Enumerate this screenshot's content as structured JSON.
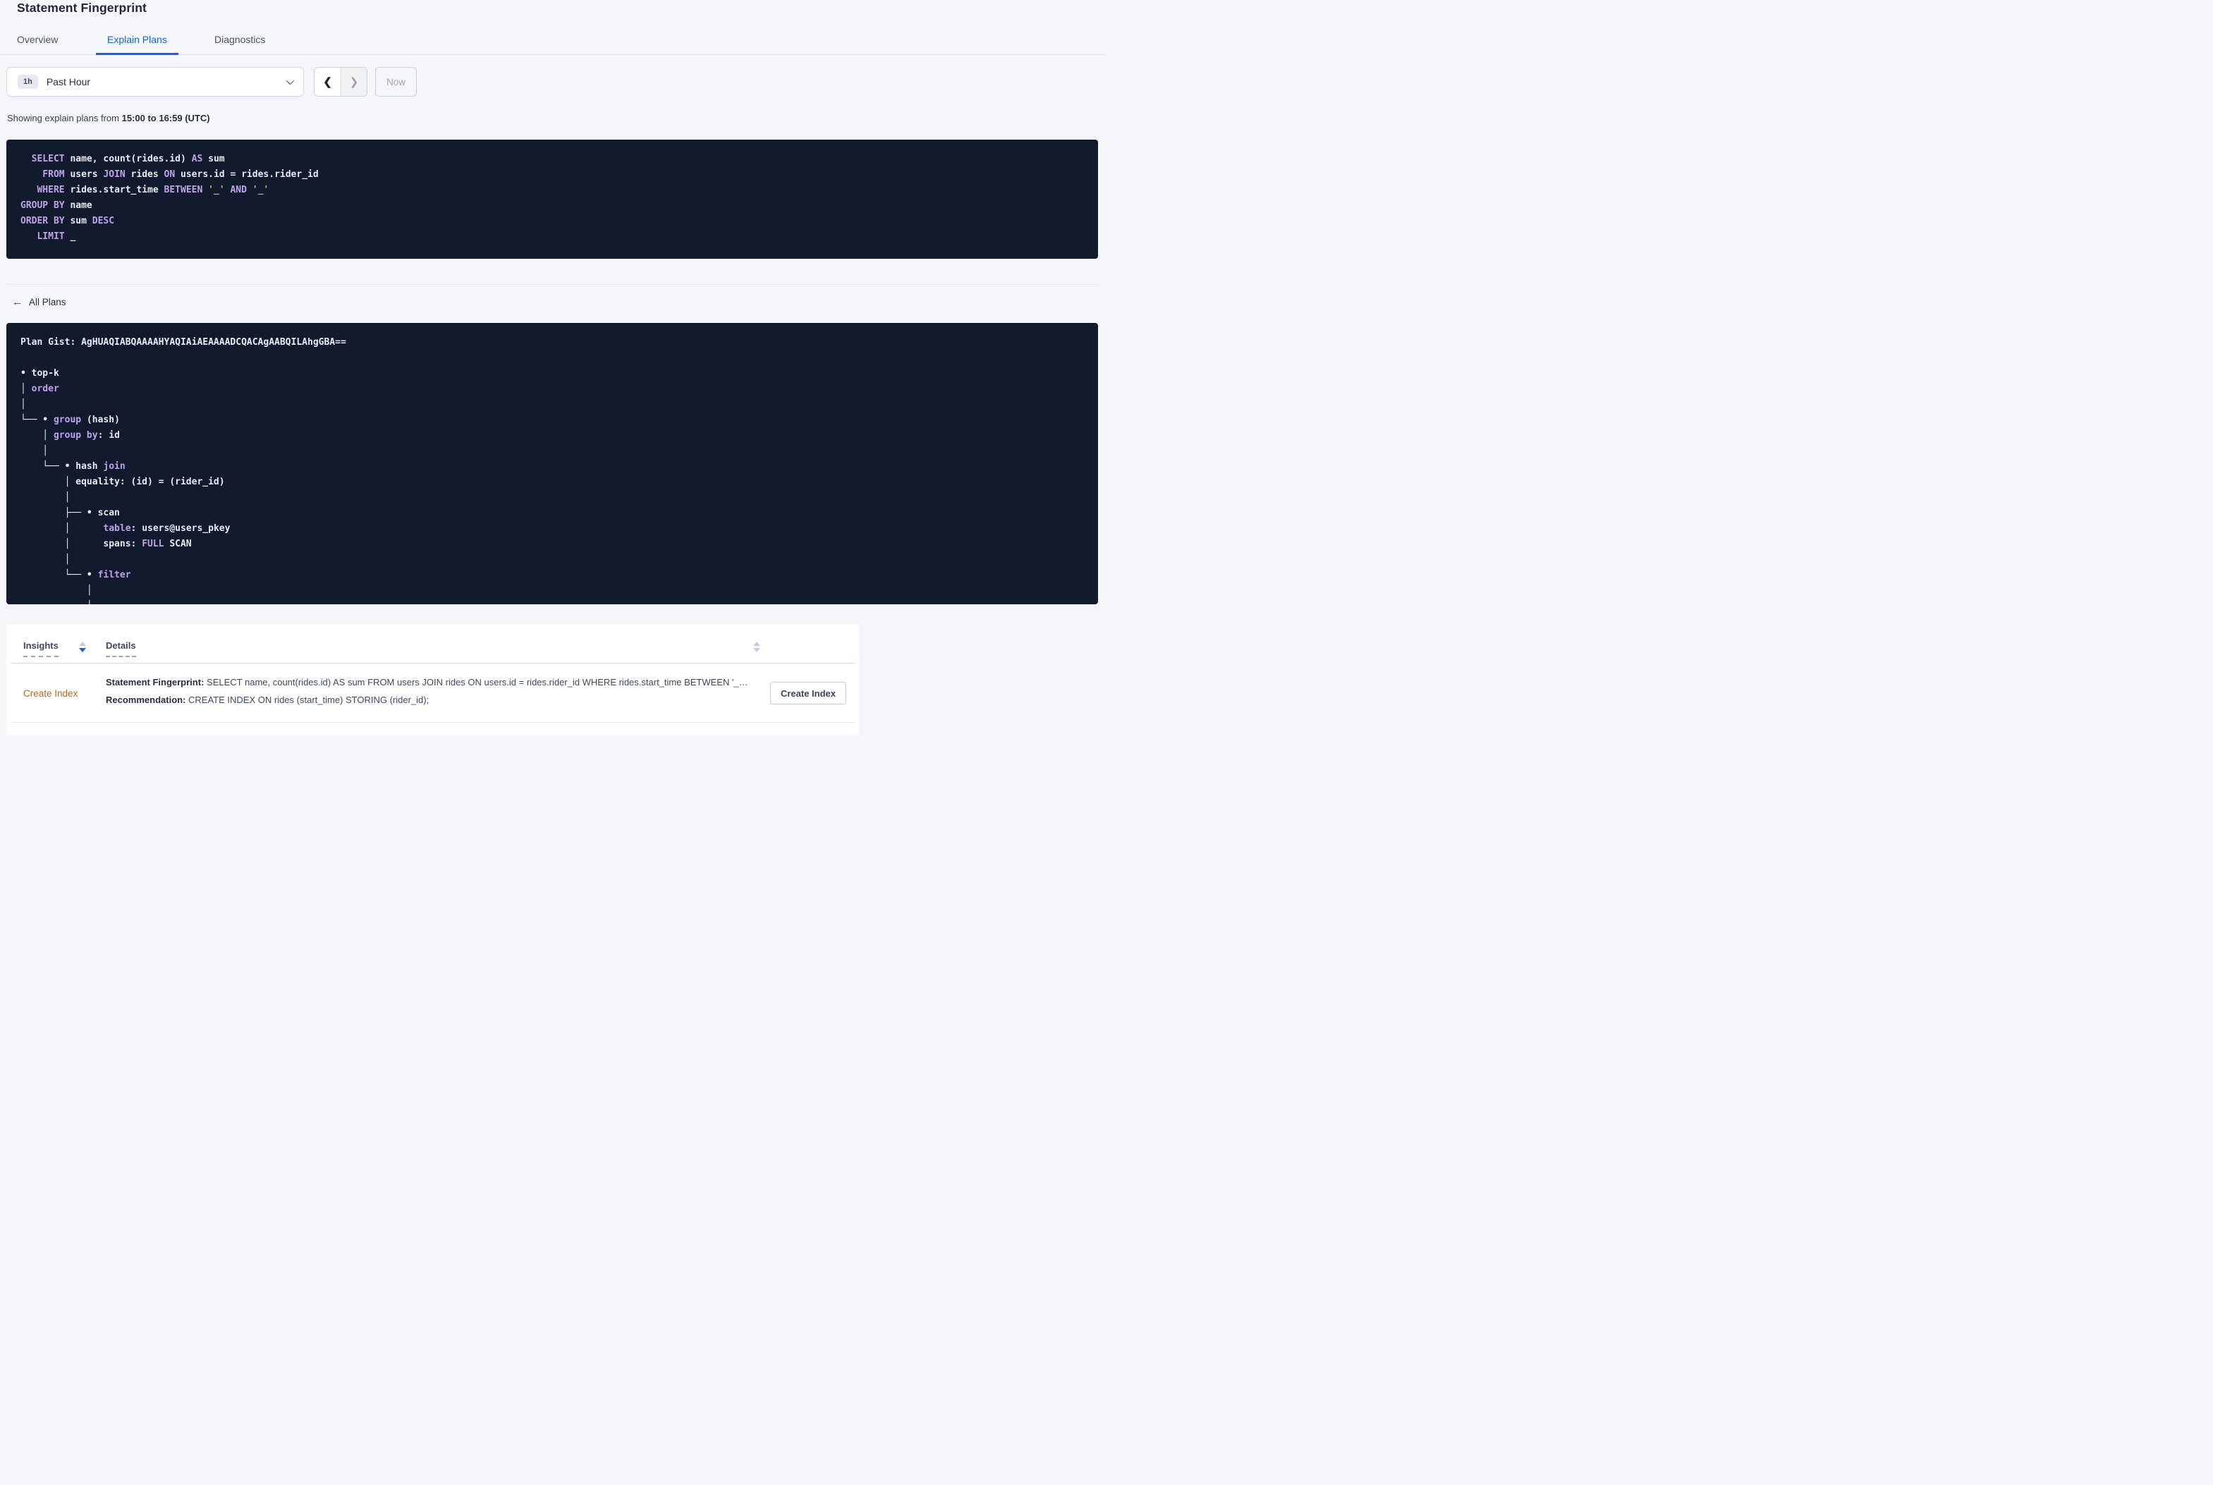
{
  "page": {
    "title": "Statement Fingerprint"
  },
  "tabs": [
    {
      "label": "Overview",
      "active": false
    },
    {
      "label": "Explain Plans",
      "active": true
    },
    {
      "label": "Diagnostics",
      "active": false
    }
  ],
  "time_picker": {
    "interval_badge": "1h",
    "selected_range": "Past Hour",
    "prev_glyph": "❮",
    "next_glyph": "❯",
    "now_label": "Now"
  },
  "range_caption": {
    "prefix": "Showing explain plans from ",
    "range_bold": "15:00 to 16:59 (UTC)"
  },
  "sql_statement": {
    "lines": [
      [
        [
          "k",
          "  SELECT"
        ],
        [
          "p",
          " name, count(rides.id) "
        ],
        [
          "k",
          "AS"
        ],
        [
          "p",
          " sum"
        ]
      ],
      [
        [
          "k",
          "    FROM"
        ],
        [
          "p",
          " users "
        ],
        [
          "k",
          "JOIN"
        ],
        [
          "p",
          " rides "
        ],
        [
          "k",
          "ON"
        ],
        [
          "p",
          " users.id = rides.rider_id"
        ]
      ],
      [
        [
          "k",
          "   WHERE"
        ],
        [
          "p",
          " rides.start_time "
        ],
        [
          "k",
          "BETWEEN"
        ],
        [
          "p",
          " "
        ],
        [
          "o",
          "'_'"
        ],
        [
          "p",
          " "
        ],
        [
          "k",
          "AND"
        ],
        [
          "p",
          " "
        ],
        [
          "o",
          "'_'"
        ]
      ],
      [
        [
          "k",
          "GROUP BY"
        ],
        [
          "p",
          " name"
        ]
      ],
      [
        [
          "k",
          "ORDER BY"
        ],
        [
          "p",
          " sum "
        ],
        [
          "k",
          "DESC"
        ]
      ],
      [
        [
          "k",
          "   LIMIT"
        ],
        [
          "p",
          " _"
        ]
      ]
    ]
  },
  "plans_nav": {
    "back_glyph": "←",
    "back_label": "All Plans"
  },
  "plan_block": {
    "gist_label": "Plan Gist: ",
    "gist_value": "AgHUAQIABQAAAAHYAQIAiAEAAAADCQACAgAABQILAhgGBA==",
    "tree": [
      [
        [
          "p",
          "• top-k"
        ]
      ],
      [
        [
          "p",
          "│ "
        ],
        [
          "k",
          "order"
        ]
      ],
      [
        [
          "p",
          "│"
        ]
      ],
      [
        [
          "p",
          "└── • "
        ],
        [
          "k",
          "group"
        ],
        [
          "p",
          " (hash)"
        ]
      ],
      [
        [
          "p",
          "    │ "
        ],
        [
          "k",
          "group by"
        ],
        [
          "p",
          ": id"
        ]
      ],
      [
        [
          "p",
          "    │"
        ]
      ],
      [
        [
          "p",
          "    └── • hash "
        ],
        [
          "k",
          "join"
        ]
      ],
      [
        [
          "p",
          "        │ equality: (id) = (rider_id)"
        ]
      ],
      [
        [
          "p",
          "        │"
        ]
      ],
      [
        [
          "p",
          "        ├── • scan"
        ]
      ],
      [
        [
          "p",
          "        │      "
        ],
        [
          "k",
          "table"
        ],
        [
          "p",
          ": users@users_pkey"
        ]
      ],
      [
        [
          "p",
          "        │      spans: "
        ],
        [
          "k",
          "FULL"
        ],
        [
          "p",
          " SCAN"
        ]
      ],
      [
        [
          "p",
          "        │"
        ]
      ],
      [
        [
          "p",
          "        └── • "
        ],
        [
          "k",
          "filter"
        ]
      ],
      [
        [
          "p",
          "            │"
        ]
      ],
      [
        [
          "p",
          "            │"
        ]
      ]
    ]
  },
  "insights_table": {
    "columns": [
      {
        "label": "Insights"
      },
      {
        "label": "Details"
      }
    ],
    "rows": [
      {
        "insight": "Create Index",
        "details": [
          {
            "label": "Statement Fingerprint:",
            "text": "SELECT name, count(rides.id) AS sum FROM users JOIN rides ON users.id = rides.rider_id WHERE rides.start_time BETWEEN '_…"
          },
          {
            "label": "Recommendation:",
            "text": "CREATE INDEX ON rides (start_time) STORING (rider_id);"
          }
        ],
        "action_label": "Create Index"
      }
    ]
  },
  "colors": {
    "accent_blue": "#0b5fff",
    "keyword_purple": "#c0a2e8",
    "literal_orange": "#f0a23c",
    "insight_link_orange": "#b5671d",
    "code_block_bg": "#121a2e",
    "page_bg": "#f5f6fa"
  }
}
